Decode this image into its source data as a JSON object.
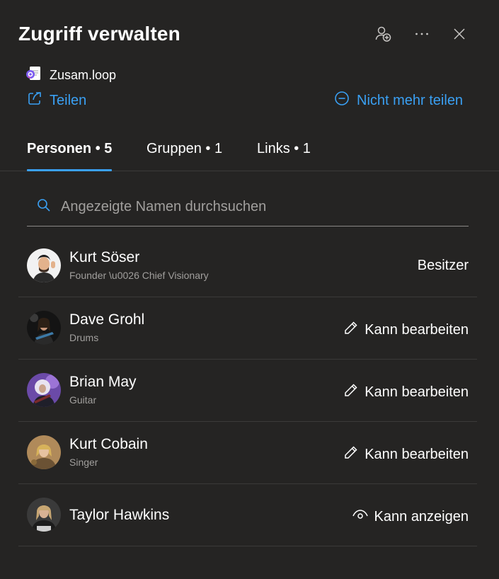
{
  "header": {
    "title": "Zugriff verwalten",
    "icons": [
      "add-person-icon",
      "more-icon",
      "close-icon"
    ]
  },
  "file": {
    "name": "Zusam.loop",
    "icon": "loop-file-icon"
  },
  "actions": {
    "share_label": "Teilen",
    "stop_sharing_label": "Nicht mehr teilen",
    "accent_color": "#3aa0f3"
  },
  "tabs": [
    {
      "label": "Personen • 5",
      "active": true
    },
    {
      "label": "Gruppen • 1",
      "active": false
    },
    {
      "label": "Links • 1",
      "active": false
    }
  ],
  "search": {
    "placeholder": "Angezeigte Namen durchsuchen",
    "value": ""
  },
  "people": [
    {
      "name": "Kurt Söser",
      "role": "Founder \\u0026 Chief Visionary",
      "permission": "Besitzer",
      "permission_icon": ""
    },
    {
      "name": "Dave Grohl",
      "role": "Drums",
      "permission": "Kann bearbeiten",
      "permission_icon": "pencil-icon"
    },
    {
      "name": "Brian May",
      "role": "Guitar",
      "permission": "Kann bearbeiten",
      "permission_icon": "pencil-icon"
    },
    {
      "name": "Kurt Cobain",
      "role": "Singer",
      "permission": "Kann bearbeiten",
      "permission_icon": "pencil-icon"
    },
    {
      "name": "Taylor Hawkins",
      "role": "",
      "permission": "Kann anzeigen",
      "permission_icon": "eye-icon"
    }
  ]
}
